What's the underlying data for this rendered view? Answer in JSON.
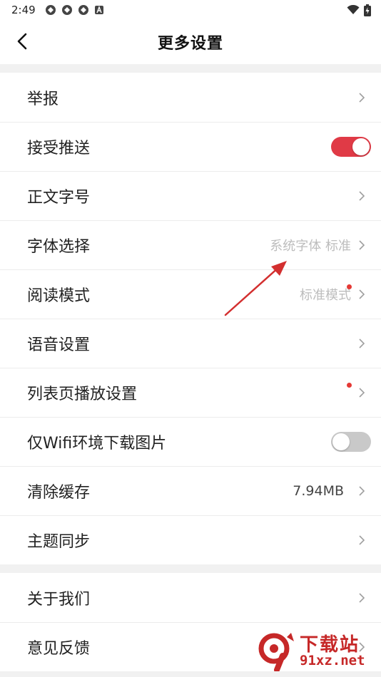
{
  "status_bar": {
    "time": "2:49",
    "icons": [
      "notification-icon",
      "notification-icon",
      "notification-icon",
      "a-icon"
    ],
    "right_icons": [
      "wifi-icon",
      "battery-charging-icon"
    ]
  },
  "header": {
    "title": "更多设置",
    "back_icon": "chevron-left-icon"
  },
  "group1": {
    "items": [
      {
        "label": "举报",
        "control": "chevron"
      },
      {
        "label": "接受推送",
        "control": "toggle",
        "state": "on"
      },
      {
        "label": "正文字号",
        "control": "chevron"
      },
      {
        "label": "字体选择",
        "value": "系统字体 标准",
        "control": "chevron"
      },
      {
        "label": "阅读模式",
        "value": "标准模式",
        "control": "chevron",
        "badge_dot": true
      },
      {
        "label": "语音设置",
        "control": "chevron"
      },
      {
        "label": "列表页播放设置",
        "control": "chevron",
        "badge_dot": true
      },
      {
        "label": "仅Wifi环境下载图片",
        "control": "toggle",
        "state": "off"
      },
      {
        "label": "清除缓存",
        "value": "7.94MB",
        "control": "chevron"
      },
      {
        "label": "主题同步",
        "control": "chevron"
      }
    ]
  },
  "group2": {
    "items": [
      {
        "label": "关于我们",
        "control": "chevron"
      },
      {
        "label": "意见反馈",
        "control": "chevron"
      }
    ]
  },
  "watermark": {
    "line1": "下载站",
    "line2": "91xz.net"
  },
  "colors": {
    "accent": "#e03a46",
    "annotation_arrow": "#d32f2f",
    "divider_gap": "#f1f1f1"
  }
}
